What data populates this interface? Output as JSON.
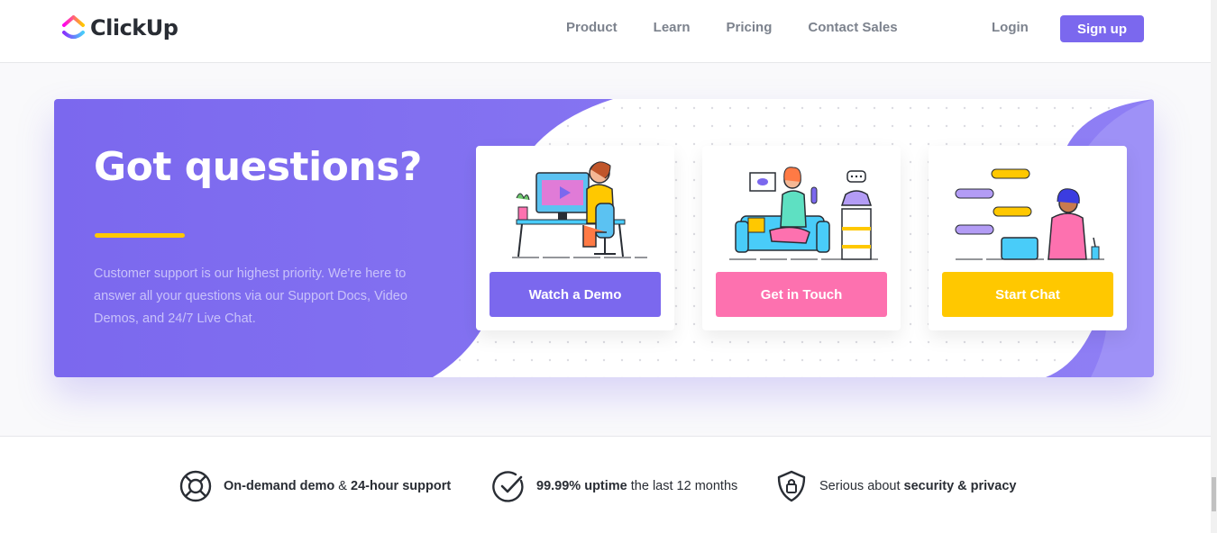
{
  "brand": {
    "name": "ClickUp"
  },
  "nav": {
    "items": [
      "Product",
      "Learn",
      "Pricing",
      "Contact Sales"
    ],
    "login": "Login",
    "signup": "Sign up"
  },
  "hero": {
    "title": "Got questions?",
    "text": "Customer support is our highest priority. We're here to answer all your questions via our Support Docs, Video Demos, and 24/7 Live Chat.",
    "cards": [
      {
        "button": "Watch a Demo",
        "color": "#7b68ee",
        "icon": "person-at-desktop-illustration"
      },
      {
        "button": "Get in Touch",
        "color": "#fd71af",
        "icon": "person-on-sofa-phone-illustration"
      },
      {
        "button": "Start Chat",
        "color": "#ffc800",
        "icon": "person-chatting-laptop-illustration"
      }
    ]
  },
  "features": [
    {
      "icon": "lifebuoy-icon",
      "bold1": "On-demand demo",
      "mid": " & ",
      "bold2": "24-hour support",
      "rest": ""
    },
    {
      "icon": "check-circle-icon",
      "bold1": "99.99% uptime",
      "mid": " the last 12 months",
      "bold2": "",
      "rest": ""
    },
    {
      "icon": "shield-lock-icon",
      "pre": "Serious about ",
      "bold1": "security & privacy"
    }
  ],
  "colors": {
    "accent": "#7b68ee",
    "pink": "#fd71af",
    "yellow": "#ffc800"
  }
}
